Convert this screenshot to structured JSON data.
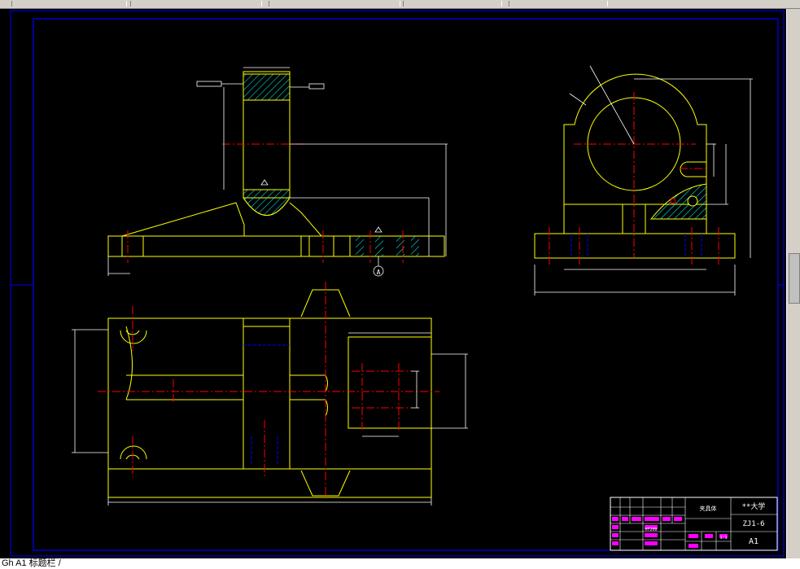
{
  "colors": {
    "background": "#000000",
    "part_outline": "#ffff00",
    "centerline": "#ff0000",
    "frame": "#0000ff",
    "dimension": "#ffffff",
    "hatch": "#00ffff",
    "title_text_magenta": "#ff00ff"
  },
  "title_block": {
    "school": "**大学",
    "drawing_number": "ZJ1-6",
    "sheet_size": "A1",
    "part_name": "夹具体",
    "scale": "1:1",
    "material": "HT200"
  },
  "section_marker": "A",
  "command_line": "Gh A1 标题栏 /"
}
